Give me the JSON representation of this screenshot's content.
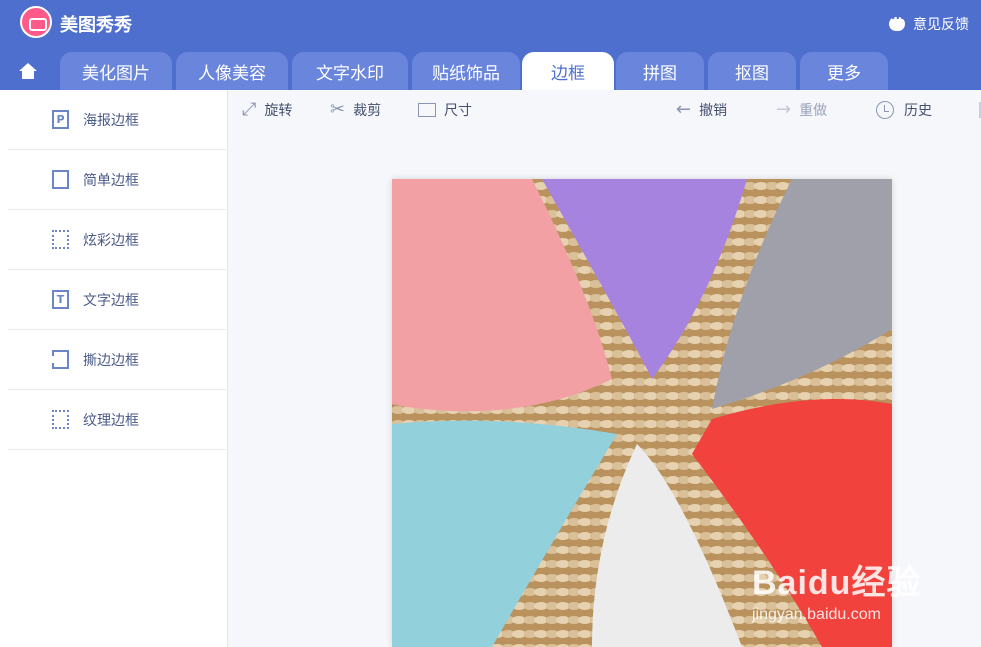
{
  "app": {
    "title": "美图秀秀",
    "feedback": "意见反馈"
  },
  "tabs": [
    "美化图片",
    "人像美容",
    "文字水印",
    "贴纸饰品",
    "边框",
    "拼图",
    "抠图",
    "更多"
  ],
  "active_tab": "边框",
  "sidebar": {
    "items": [
      {
        "label": "海报边框",
        "icon": "poster-frame-icon"
      },
      {
        "label": "简单边框",
        "icon": "simple-frame-icon"
      },
      {
        "label": "炫彩边框",
        "icon": "colorful-frame-icon"
      },
      {
        "label": "文字边框",
        "icon": "text-frame-icon"
      },
      {
        "label": "撕边边框",
        "icon": "torn-frame-icon"
      },
      {
        "label": "纹理边框",
        "icon": "texture-frame-icon"
      }
    ]
  },
  "toolbar": {
    "rotate": "旋转",
    "crop": "裁剪",
    "size": "尺寸",
    "undo": "撤销",
    "redo": "重做",
    "history": "历史"
  },
  "watermark": {
    "brand": "Baidu经验",
    "url": "jingyan.baidu.com"
  },
  "colors": {
    "accent": "#4f6fcf",
    "tab": "#6a86dc"
  },
  "photo": {
    "description_icons": [
      "pink-fabric",
      "purple-fabric",
      "gray-fabric",
      "red-fabric",
      "white-fabric",
      "blue-fabric"
    ]
  }
}
